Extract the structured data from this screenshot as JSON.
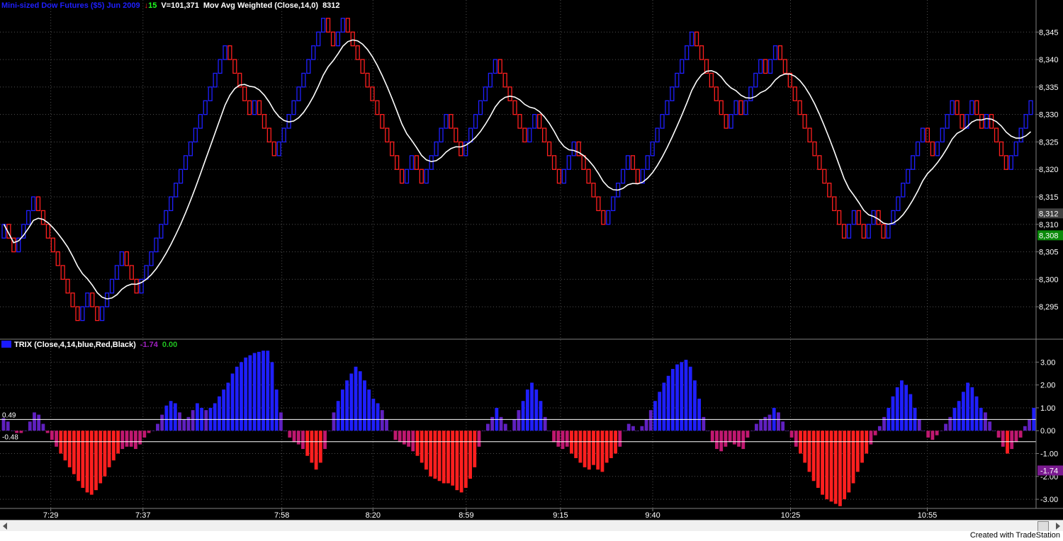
{
  "header": {
    "symbol": "Mini-sized Dow Futures ($5) Jun 2009",
    "arrow": "↓",
    "change": "15",
    "volume": "V=101,371",
    "indicator": "Mov Avg Weighted (Close,14,0)",
    "last": "8312"
  },
  "trix_header": {
    "label": "TRIX (Close,4,14,blue,Red,Black)",
    "value1": "-1.74",
    "value2": "0.00"
  },
  "footer": {
    "text": "Created with TradeStation"
  },
  "colors": {
    "up": "#1f1fff",
    "down": "#ff1f1f",
    "ma": "#ffffff",
    "grid": "#505050",
    "axis_text": "#ffffff"
  },
  "chart_data": [
    {
      "type": "renko",
      "title": "Mini-sized Dow Futures ($5) Jun 2009",
      "brick_size": 2.5,
      "ylim": [
        8290,
        8348
      ],
      "y_ticks": [
        "8,295",
        "8,300",
        "8,305",
        "8,310",
        "8,315",
        "8,320",
        "8,325",
        "8,330",
        "8,335",
        "8,340",
        "8,345"
      ],
      "y_tick_values": [
        8295,
        8300,
        8305,
        8310,
        8315,
        8320,
        8325,
        8330,
        8335,
        8340,
        8345
      ],
      "price_tags": [
        {
          "label": "8,312",
          "value": 8312,
          "color": "#404040"
        },
        {
          "label": "8,308",
          "value": 8308,
          "color": "#0a8a0a"
        }
      ],
      "bricks": [
        [
          "u",
          8310
        ],
        [
          "d",
          8307.5
        ],
        [
          "d",
          8305
        ],
        [
          "u",
          8307.5
        ],
        [
          "u",
          8310
        ],
        [
          "u",
          8312.5
        ],
        [
          "u",
          8315
        ],
        [
          "d",
          8312.5
        ],
        [
          "d",
          8310
        ],
        [
          "d",
          8307.5
        ],
        [
          "d",
          8305
        ],
        [
          "d",
          8302.5
        ],
        [
          "d",
          8300
        ],
        [
          "d",
          8297.5
        ],
        [
          "d",
          8295
        ],
        [
          "d",
          8292.5
        ],
        [
          "u",
          8295
        ],
        [
          "u",
          8297.5
        ],
        [
          "d",
          8295
        ],
        [
          "d",
          8292.5
        ],
        [
          "u",
          8295
        ],
        [
          "u",
          8297.5
        ],
        [
          "u",
          8300
        ],
        [
          "u",
          8302.5
        ],
        [
          "u",
          8305
        ],
        [
          "d",
          8302.5
        ],
        [
          "d",
          8300
        ],
        [
          "d",
          8297.5
        ],
        [
          "u",
          8300
        ],
        [
          "u",
          8302.5
        ],
        [
          "u",
          8305
        ],
        [
          "u",
          8307.5
        ],
        [
          "u",
          8310
        ],
        [
          "u",
          8312.5
        ],
        [
          "u",
          8315
        ],
        [
          "u",
          8317.5
        ],
        [
          "u",
          8320
        ],
        [
          "u",
          8322.5
        ],
        [
          "u",
          8325
        ],
        [
          "u",
          8327.5
        ],
        [
          "u",
          8330
        ],
        [
          "u",
          8332.5
        ],
        [
          "u",
          8335
        ],
        [
          "u",
          8337.5
        ],
        [
          "u",
          8340
        ],
        [
          "u",
          8342.5
        ],
        [
          "d",
          8340
        ],
        [
          "d",
          8337.5
        ],
        [
          "d",
          8335
        ],
        [
          "d",
          8332.5
        ],
        [
          "d",
          8330
        ],
        [
          "u",
          8332.5
        ],
        [
          "d",
          8330
        ],
        [
          "d",
          8327.5
        ],
        [
          "d",
          8325
        ],
        [
          "d",
          8322.5
        ],
        [
          "u",
          8325
        ],
        [
          "u",
          8327.5
        ],
        [
          "u",
          8330
        ],
        [
          "u",
          8332.5
        ],
        [
          "u",
          8335
        ],
        [
          "u",
          8337.5
        ],
        [
          "u",
          8340
        ],
        [
          "u",
          8342.5
        ],
        [
          "u",
          8345
        ],
        [
          "u",
          8347.5
        ],
        [
          "d",
          8345
        ],
        [
          "d",
          8342.5
        ],
        [
          "u",
          8345
        ],
        [
          "u",
          8347.5
        ],
        [
          "d",
          8345
        ],
        [
          "d",
          8342.5
        ],
        [
          "d",
          8340
        ],
        [
          "d",
          8337.5
        ],
        [
          "d",
          8335
        ],
        [
          "d",
          8332.5
        ],
        [
          "d",
          8330
        ],
        [
          "d",
          8327.5
        ],
        [
          "d",
          8325
        ],
        [
          "d",
          8322.5
        ],
        [
          "d",
          8320
        ],
        [
          "d",
          8317.5
        ],
        [
          "u",
          8320
        ],
        [
          "u",
          8322.5
        ],
        [
          "d",
          8320
        ],
        [
          "d",
          8317.5
        ],
        [
          "u",
          8320
        ],
        [
          "u",
          8322.5
        ],
        [
          "u",
          8325
        ],
        [
          "u",
          8327.5
        ],
        [
          "u",
          8330
        ],
        [
          "d",
          8327.5
        ],
        [
          "d",
          8325
        ],
        [
          "d",
          8322.5
        ],
        [
          "u",
          8325
        ],
        [
          "u",
          8327.5
        ],
        [
          "u",
          8330
        ],
        [
          "u",
          8332.5
        ],
        [
          "u",
          8335
        ],
        [
          "u",
          8337.5
        ],
        [
          "u",
          8340
        ],
        [
          "d",
          8337.5
        ],
        [
          "d",
          8335
        ],
        [
          "d",
          8332.5
        ],
        [
          "d",
          8330
        ],
        [
          "d",
          8327.5
        ],
        [
          "d",
          8325
        ],
        [
          "u",
          8327.5
        ],
        [
          "u",
          8330
        ],
        [
          "d",
          8327.5
        ],
        [
          "d",
          8325
        ],
        [
          "d",
          8322.5
        ],
        [
          "d",
          8320
        ],
        [
          "d",
          8317.5
        ],
        [
          "u",
          8320
        ],
        [
          "u",
          8322.5
        ],
        [
          "u",
          8325
        ],
        [
          "d",
          8322.5
        ],
        [
          "d",
          8320
        ],
        [
          "d",
          8317.5
        ],
        [
          "d",
          8315
        ],
        [
          "d",
          8312.5
        ],
        [
          "d",
          8310
        ],
        [
          "u",
          8312.5
        ],
        [
          "u",
          8315
        ],
        [
          "u",
          8317.5
        ],
        [
          "u",
          8320
        ],
        [
          "u",
          8322.5
        ],
        [
          "d",
          8320
        ],
        [
          "d",
          8317.5
        ],
        [
          "u",
          8320
        ],
        [
          "u",
          8322.5
        ],
        [
          "u",
          8325
        ],
        [
          "u",
          8327.5
        ],
        [
          "u",
          8330
        ],
        [
          "u",
          8332.5
        ],
        [
          "u",
          8335
        ],
        [
          "u",
          8337.5
        ],
        [
          "u",
          8340
        ],
        [
          "u",
          8342.5
        ],
        [
          "u",
          8345
        ],
        [
          "d",
          8342.5
        ],
        [
          "d",
          8340
        ],
        [
          "d",
          8337.5
        ],
        [
          "d",
          8335
        ],
        [
          "d",
          8332.5
        ],
        [
          "d",
          8330
        ],
        [
          "d",
          8327.5
        ],
        [
          "u",
          8330
        ],
        [
          "u",
          8332.5
        ],
        [
          "d",
          8330
        ],
        [
          "u",
          8332.5
        ],
        [
          "u",
          8335
        ],
        [
          "u",
          8337.5
        ],
        [
          "u",
          8340
        ],
        [
          "d",
          8337.5
        ],
        [
          "u",
          8340
        ],
        [
          "u",
          8342.5
        ],
        [
          "d",
          8340
        ],
        [
          "d",
          8337.5
        ],
        [
          "d",
          8335
        ],
        [
          "d",
          8332.5
        ],
        [
          "d",
          8330
        ],
        [
          "d",
          8327.5
        ],
        [
          "d",
          8325
        ],
        [
          "d",
          8322.5
        ],
        [
          "d",
          8320
        ],
        [
          "d",
          8317.5
        ],
        [
          "d",
          8315
        ],
        [
          "d",
          8312.5
        ],
        [
          "d",
          8310
        ],
        [
          "d",
          8307.5
        ],
        [
          "u",
          8310
        ],
        [
          "u",
          8312.5
        ],
        [
          "d",
          8310
        ],
        [
          "d",
          8307.5
        ],
        [
          "u",
          8310
        ],
        [
          "u",
          8312.5
        ],
        [
          "d",
          8310
        ],
        [
          "d",
          8307.5
        ],
        [
          "u",
          8310
        ],
        [
          "u",
          8312.5
        ],
        [
          "u",
          8315
        ],
        [
          "u",
          8317.5
        ],
        [
          "u",
          8320
        ],
        [
          "u",
          8322.5
        ],
        [
          "u",
          8325
        ],
        [
          "u",
          8327.5
        ],
        [
          "d",
          8325
        ],
        [
          "d",
          8322.5
        ],
        [
          "u",
          8325
        ],
        [
          "u",
          8327.5
        ],
        [
          "u",
          8330
        ],
        [
          "u",
          8332.5
        ],
        [
          "d",
          8330
        ],
        [
          "d",
          8327.5
        ],
        [
          "u",
          8330
        ],
        [
          "u",
          8332.5
        ],
        [
          "d",
          8330
        ],
        [
          "d",
          8327.5
        ],
        [
          "u",
          8330
        ],
        [
          "d",
          8327.5
        ],
        [
          "d",
          8325
        ],
        [
          "d",
          8322.5
        ],
        [
          "d",
          8320
        ],
        [
          "u",
          8322.5
        ],
        [
          "u",
          8325
        ],
        [
          "u",
          8327.5
        ],
        [
          "u",
          8330
        ],
        [
          "u",
          8332.5
        ]
      ],
      "ma_name": "Mov Avg Weighted (Close,14,0)"
    },
    {
      "type": "bar",
      "title": "TRIX (Close,4,14,blue,Red,Black)",
      "ylim": [
        -3.4,
        3.6
      ],
      "y_ticks": [
        "3.00",
        "2.00",
        "1.00",
        "0.00",
        "-1.00",
        "-2.00",
        "-3.00"
      ],
      "y_tick_values": [
        3,
        2,
        1,
        0,
        -1,
        -2,
        -3
      ],
      "levels": [
        {
          "label": "0.49",
          "value": 0.49
        },
        {
          "label": "-0.48",
          "value": -0.48
        }
      ],
      "value_tag": {
        "label": "-1.74",
        "value": -1.74
      },
      "values": [
        0.55,
        0.4,
        0.0,
        -0.1,
        -0.1,
        0.0,
        0.4,
        0.8,
        0.7,
        0.3,
        -0.1,
        -0.4,
        -0.7,
        -1.0,
        -1.3,
        -1.6,
        -1.9,
        -2.2,
        -2.5,
        -2.7,
        -2.8,
        -2.6,
        -2.3,
        -2.0,
        -1.6,
        -1.3,
        -1.0,
        -0.8,
        -0.7,
        -0.7,
        -0.8,
        -0.6,
        -0.3,
        -0.1,
        0.0,
        0.3,
        0.7,
        1.1,
        1.3,
        1.2,
        0.8,
        0.5,
        0.6,
        0.9,
        1.2,
        1.0,
        0.9,
        1.0,
        1.2,
        1.5,
        1.8,
        2.1,
        2.5,
        2.8,
        3.0,
        3.2,
        3.3,
        3.4,
        3.45,
        3.5,
        3.5,
        3.0,
        1.8,
        0.8,
        0.0,
        -0.3,
        -0.5,
        -0.6,
        -0.8,
        -1.1,
        -1.4,
        -1.7,
        -1.4,
        -0.8,
        0.0,
        0.8,
        1.3,
        1.8,
        2.2,
        2.5,
        2.8,
        2.6,
        2.2,
        1.8,
        1.4,
        1.2,
        0.9,
        0.5,
        0.0,
        -0.4,
        -0.5,
        -0.6,
        -0.7,
        -0.9,
        -1.1,
        -1.4,
        -1.7,
        -2.0,
        -2.1,
        -2.2,
        -2.3,
        -2.3,
        -2.4,
        -2.6,
        -2.7,
        -2.5,
        -2.1,
        -1.6,
        -0.7,
        0.0,
        0.3,
        0.6,
        1.0,
        0.6,
        0.3,
        0.0,
        0.5,
        0.9,
        1.3,
        1.8,
        2.1,
        1.8,
        1.3,
        0.6,
        0.0,
        -0.5,
        -0.7,
        -0.8,
        -0.7,
        -1.0,
        -1.2,
        -1.4,
        -1.6,
        -1.7,
        -1.5,
        -1.7,
        -1.8,
        -1.4,
        -1.2,
        -1.0,
        -0.7,
        0.0,
        0.3,
        0.2,
        0.0,
        0.2,
        0.5,
        0.9,
        1.3,
        1.7,
        2.1,
        2.4,
        2.7,
        2.9,
        3.0,
        3.1,
        2.8,
        2.2,
        1.4,
        0.6,
        0.0,
        -0.5,
        -0.8,
        -0.9,
        -0.7,
        -0.5,
        -0.6,
        -0.7,
        -0.8,
        -0.3,
        0.0,
        0.3,
        0.5,
        0.6,
        0.7,
        1.0,
        0.8,
        0.4,
        0.0,
        -0.3,
        -0.7,
        -1.0,
        -1.4,
        -1.8,
        -2.2,
        -2.5,
        -2.8,
        -3.0,
        -3.1,
        -3.2,
        -3.3,
        -3.0,
        -2.7,
        -2.3,
        -1.8,
        -1.4,
        -1.0,
        -0.6,
        -0.2,
        0.2,
        0.6,
        1.0,
        1.5,
        1.9,
        2.2,
        2.0,
        1.6,
        1.0,
        0.5,
        0.0,
        -0.3,
        -0.4,
        -0.2,
        0.0,
        0.3,
        0.6,
        1.0,
        1.3,
        1.7,
        2.1,
        1.9,
        1.5,
        1.0,
        0.8,
        0.4,
        0.0,
        -0.3,
        -0.7,
        -1.0,
        -0.8,
        -0.5,
        -0.3,
        0.2,
        0.5,
        1.0
      ]
    }
  ],
  "x_ticks": [
    {
      "label": "7:29",
      "at": 0.049
    },
    {
      "label": "7:37",
      "at": 0.138
    },
    {
      "label": "7:58",
      "at": 0.272
    },
    {
      "label": "8:20",
      "at": 0.36
    },
    {
      "label": "8:59",
      "at": 0.45
    },
    {
      "label": "9:15",
      "at": 0.541
    },
    {
      "label": "9:40",
      "at": 0.63
    },
    {
      "label": "10:25",
      "at": 0.763
    },
    {
      "label": "10:55",
      "at": 0.895
    }
  ]
}
